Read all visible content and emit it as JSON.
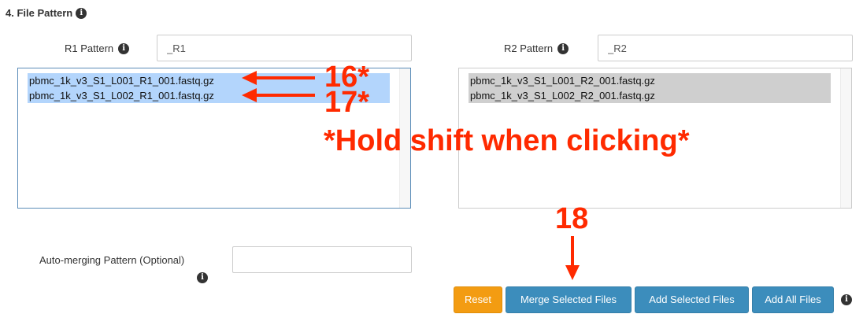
{
  "section": {
    "title": "4. File Pattern",
    "title_icon": "info-circle-icon"
  },
  "r1": {
    "label": "R1 Pattern",
    "value": "_R1",
    "files": [
      "pbmc_1k_v3_S1_L001_R1_001.fastq.gz",
      "pbmc_1k_v3_S1_L002_R1_001.fastq.gz"
    ],
    "selection_color": "#b3d5fc"
  },
  "r2": {
    "label": "R2 Pattern",
    "value": "_R2",
    "files": [
      "pbmc_1k_v3_S1_L001_R2_001.fastq.gz",
      "pbmc_1k_v3_S1_L002_R2_001.fastq.gz"
    ],
    "selection_color": "#cfcfcf"
  },
  "auto_merge": {
    "label": "Auto-merging Pattern (Optional)",
    "value": ""
  },
  "buttons": {
    "reset": "Reset",
    "merge": "Merge Selected Files",
    "add_selected": "Add Selected Files",
    "add_all": "Add All Files"
  },
  "colors": {
    "warning": "#f39c12",
    "primary": "#3c8dbc",
    "annotation": "#ff2a00"
  },
  "annotations": {
    "step16": "16*",
    "step17": "17*",
    "step18": "18",
    "hint": "*Hold shift when clicking*"
  }
}
